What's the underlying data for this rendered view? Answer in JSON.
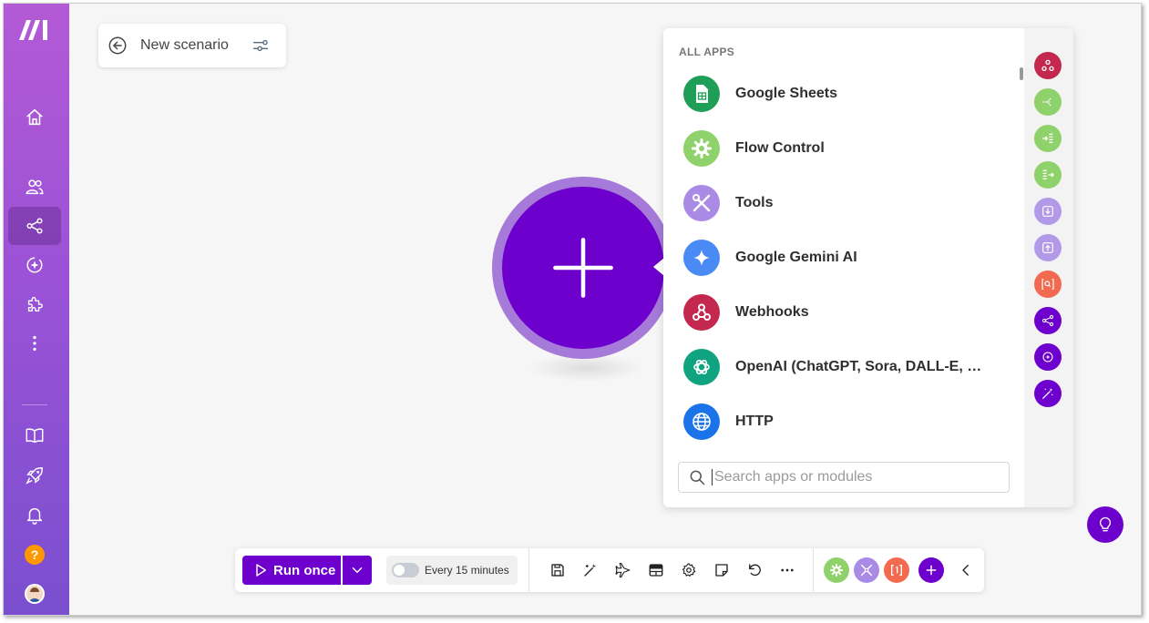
{
  "scenario": {
    "title": "New scenario"
  },
  "sidebar": {
    "items": [
      {
        "name": "home"
      },
      {
        "name": "team"
      },
      {
        "name": "scenarios",
        "active": true
      },
      {
        "name": "ai-agents"
      },
      {
        "name": "extensions"
      },
      {
        "name": "more"
      },
      {
        "name": "docs"
      },
      {
        "name": "whats-new"
      },
      {
        "name": "notifications"
      },
      {
        "name": "help",
        "label": "?"
      },
      {
        "name": "profile"
      }
    ]
  },
  "apps_panel": {
    "heading": "ALL APPS",
    "apps": [
      {
        "label": "Google Sheets",
        "color": "#1e9e57",
        "icon": "sheets-icon"
      },
      {
        "label": "Flow Control",
        "color": "#8fd16a",
        "icon": "gear-icon"
      },
      {
        "label": "Tools",
        "color": "#a98be6",
        "icon": "tools-icon"
      },
      {
        "label": "Google Gemini AI",
        "color": "#4a8af4",
        "icon": "sparkle-icon"
      },
      {
        "label": "Webhooks",
        "color": "#c5284f",
        "icon": "webhook-icon"
      },
      {
        "label": "OpenAI (ChatGPT, Sora, DALL-E, Whisper)",
        "color": "#10a37f",
        "icon": "openai-icon"
      },
      {
        "label": "HTTP",
        "color": "#1a73e8",
        "icon": "globe-icon"
      }
    ],
    "search_placeholder": "Search apps or modules",
    "rail": [
      {
        "icon": "webhook-icon",
        "color": "#c5284f"
      },
      {
        "icon": "router-icon",
        "color": "#8fd16a"
      },
      {
        "icon": "iterator-icon",
        "color": "#8fd16a"
      },
      {
        "icon": "aggregator-icon",
        "color": "#8fd16a"
      },
      {
        "icon": "import-icon",
        "color": "#b39ae8"
      },
      {
        "icon": "export-icon",
        "color": "#b39ae8"
      },
      {
        "icon": "search-text-icon",
        "color": "#f26a4f"
      },
      {
        "icon": "share-icon",
        "color": "#6d00cc"
      },
      {
        "icon": "ai-icon",
        "color": "#6d00cc"
      },
      {
        "icon": "magic-wand-icon",
        "color": "#6d00cc"
      }
    ]
  },
  "toolbar": {
    "run_label": "Run once",
    "schedule_label": "Every 15 minutes",
    "colors": {
      "accent": "#6d00cc"
    }
  }
}
